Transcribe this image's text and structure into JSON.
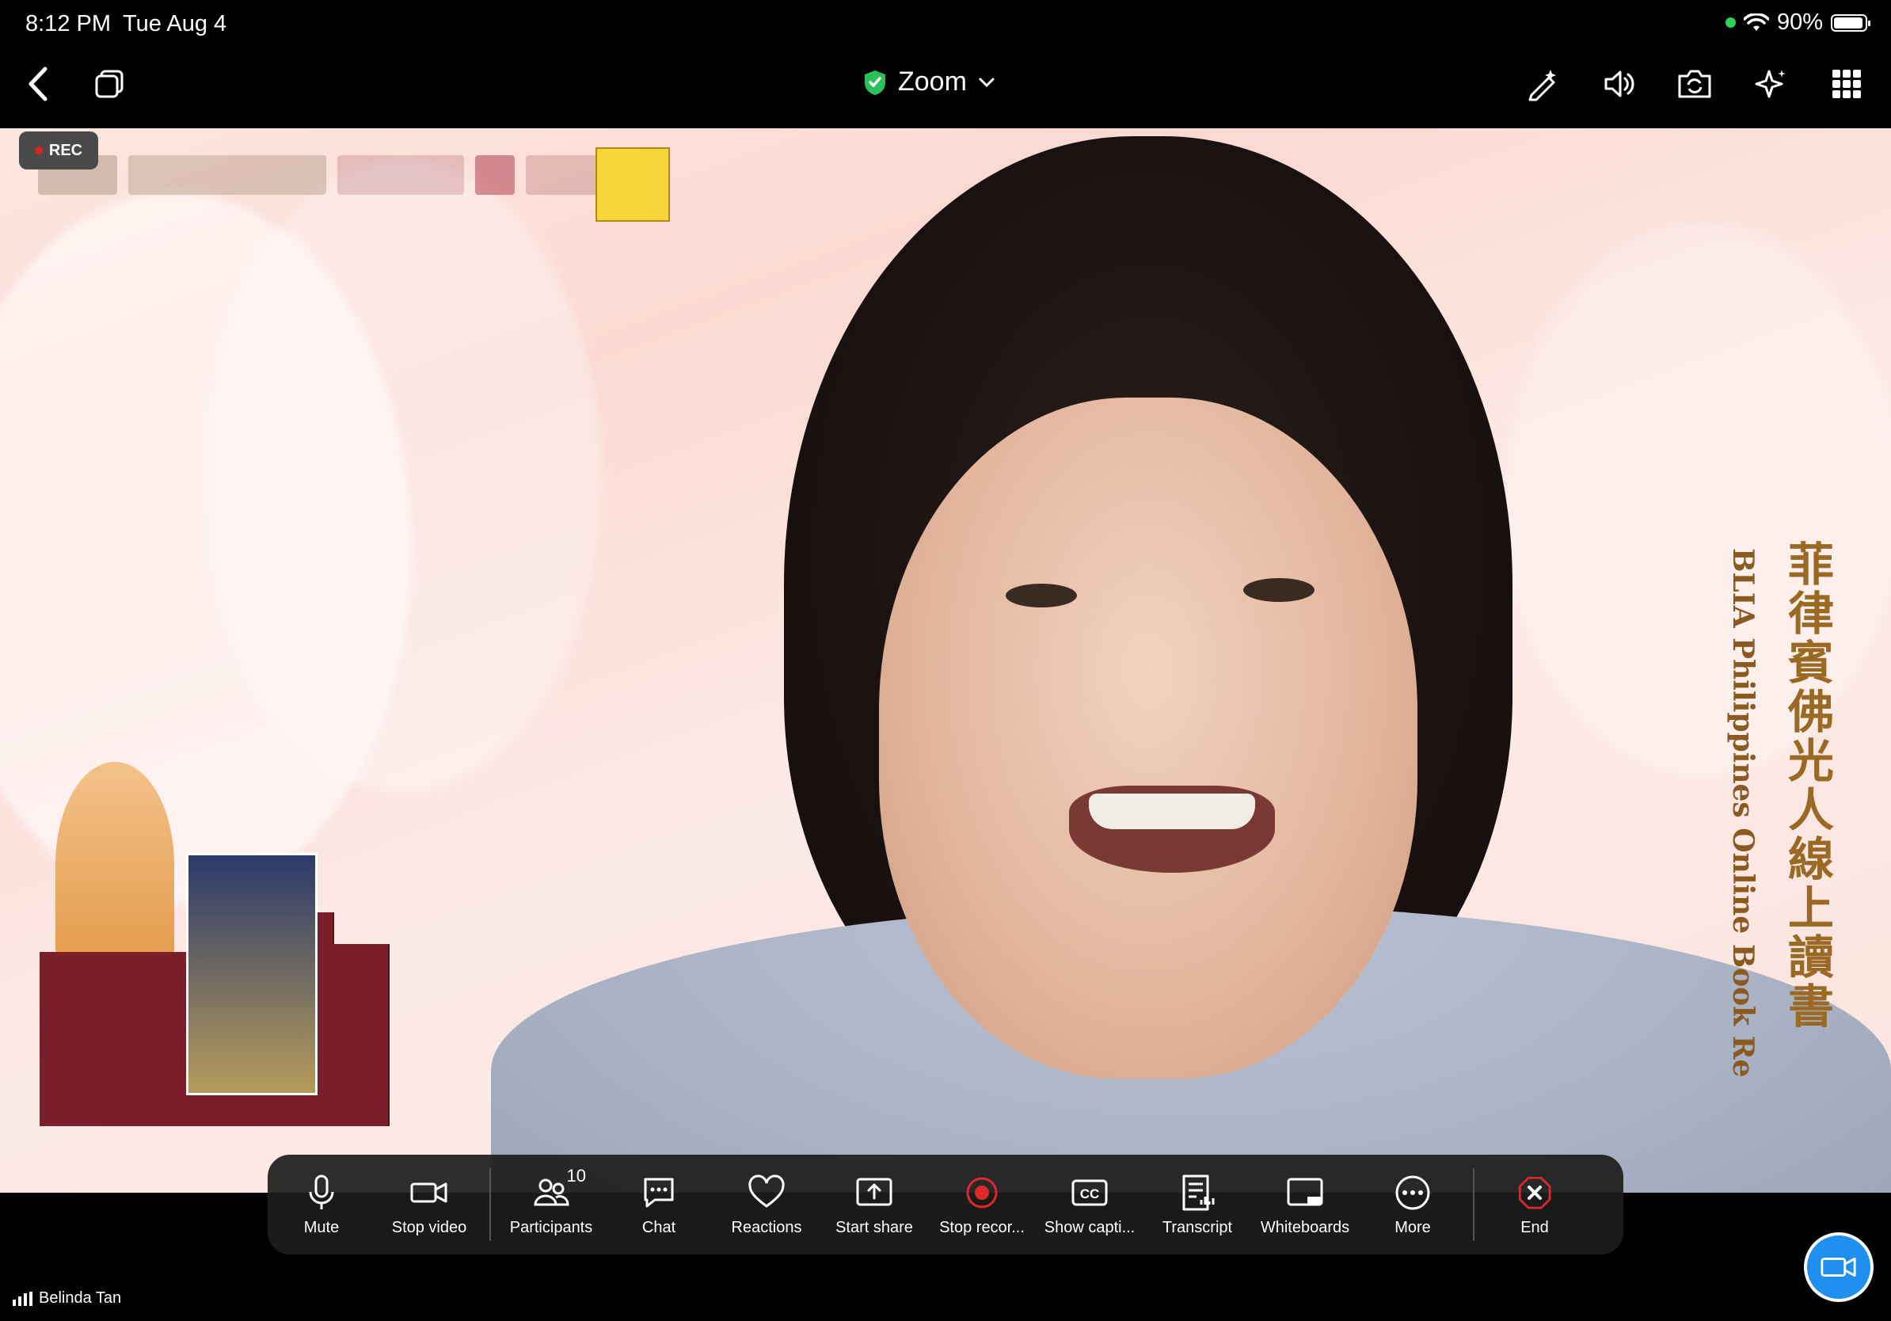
{
  "status_bar": {
    "time": "8:12 PM",
    "date": "Tue Aug 4",
    "battery": "90%"
  },
  "toolbar": {
    "title": "Zoom",
    "accent_color": "#2cc05a"
  },
  "video": {
    "rec_label": "REC",
    "banner_vertical_cn": "菲律賓佛光人線上讀書",
    "banner_vertical_en": "BLIA Philippines Online Book Re"
  },
  "controls": {
    "mute": "Mute",
    "stop_video": "Stop video",
    "participants": "Participants",
    "participants_count": "10",
    "chat": "Chat",
    "reactions": "Reactions",
    "start_share": "Start share",
    "stop_recording": "Stop recor...",
    "show_captions": "Show capti...",
    "transcript": "Transcript",
    "whiteboards": "Whiteboards",
    "more": "More",
    "end": "End"
  },
  "participant": {
    "name": "Belinda Tan"
  }
}
